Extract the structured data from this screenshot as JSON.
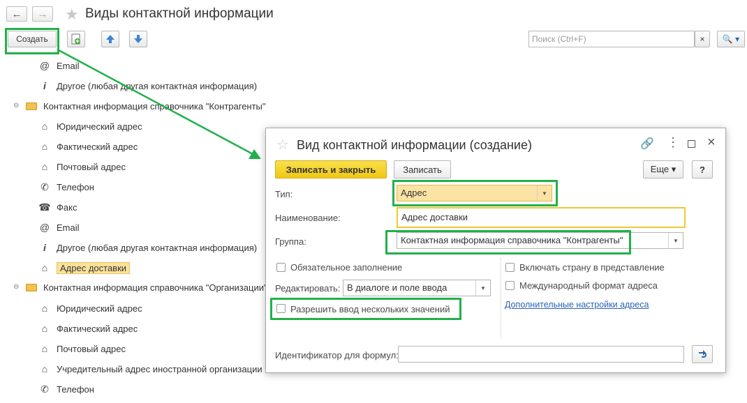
{
  "window": {
    "title": "Виды контактной информации"
  },
  "toolbar": {
    "create_label": "Создать",
    "search_placeholder": "Поиск (Ctrl+F)",
    "search_clear": "×",
    "search_btn": "🔍 ▾"
  },
  "list": {
    "items": [
      {
        "icon": "@",
        "label": "Email"
      },
      {
        "icon": "i",
        "label": "Другое (любая другая контактная информация)"
      },
      {
        "group": true,
        "label": "Контактная информация справочника \"Контрагенты\""
      },
      {
        "icon": "⌂",
        "label": "Юридический адрес"
      },
      {
        "icon": "⌂",
        "label": "Фактический адрес"
      },
      {
        "icon": "⌂",
        "label": "Почтовый адрес"
      },
      {
        "icon": "✆",
        "label": "Телефон"
      },
      {
        "icon": "☎",
        "label": "Факс"
      },
      {
        "icon": "@",
        "label": "Email"
      },
      {
        "icon": "i",
        "label": "Другое (любая другая контактная информация)"
      },
      {
        "icon": "⌂",
        "label": "Адрес доставки"
      },
      {
        "group": true,
        "label": "Контактная информация справочника \"Организации\""
      },
      {
        "icon": "⌂",
        "label": "Юридический адрес"
      },
      {
        "icon": "⌂",
        "label": "Фактический адрес"
      },
      {
        "icon": "⌂",
        "label": "Почтовый адрес"
      },
      {
        "icon": "⌂",
        "label": "Учредительный адрес иностранной организации"
      },
      {
        "icon": "✆",
        "label": "Телефон"
      }
    ]
  },
  "dialog": {
    "title": "Вид контактной информации (создание)",
    "save_close": "Записать и закрыть",
    "save": "Записать",
    "more": "Еще ▾",
    "help": "?",
    "type_label": "Тип:",
    "type_value": "Адрес",
    "name_label": "Наименование:",
    "name_value": "Адрес доставки",
    "group_label": "Группа:",
    "group_value": "Контактная информация справочника \"Контрагенты\"",
    "required_label": "Обязательное заполнение",
    "edit_label": "Редактировать:",
    "edit_value": "В диалоге и поле ввода",
    "multi_label": "Разрешить ввод нескольких значений",
    "country_label": "Включать страну в представление",
    "intl_label": "Международный формат адреса",
    "addr_settings_link": "Дополнительные настройки адреса",
    "formula_id_label": "Идентификатор для формул:"
  },
  "colors": {
    "accent_green": "#22b04b",
    "primary_yellow": "#f5d428",
    "selection": "#fbe29a"
  }
}
